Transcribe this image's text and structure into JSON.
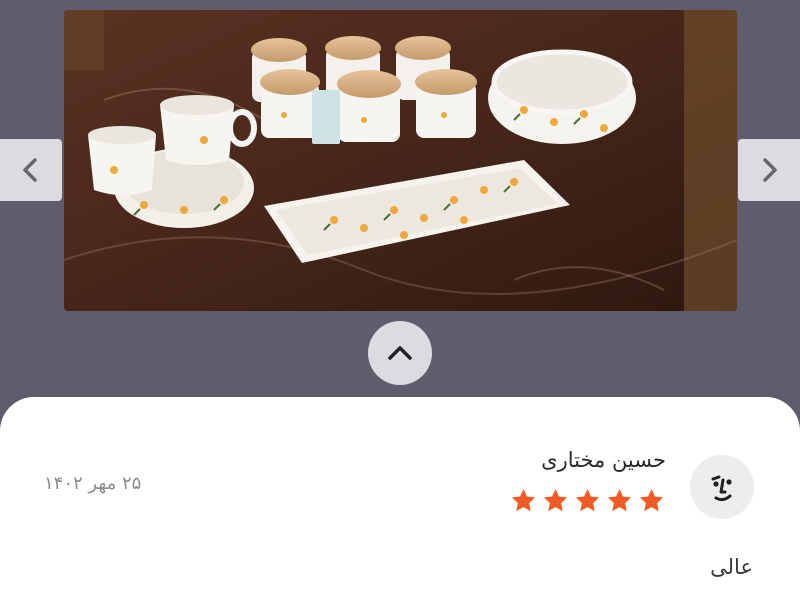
{
  "viewer": {
    "photo_alt": "",
    "prev_icon": "chevron-left-icon",
    "next_icon": "chevron-right-icon",
    "collapse_icon": "chevron-up-icon"
  },
  "review": {
    "reviewer_name": "حسین مختاری",
    "date": "۲۵ مهر ۱۴۰۲",
    "rating": 5,
    "rating_max": 5,
    "text": "عالی",
    "avatar_icon": "face-avatar-icon",
    "star_color": "#f05a28"
  },
  "colors": {
    "background": "#5e5d6c",
    "button": "#dcdbe0",
    "card": "#ffffff"
  }
}
